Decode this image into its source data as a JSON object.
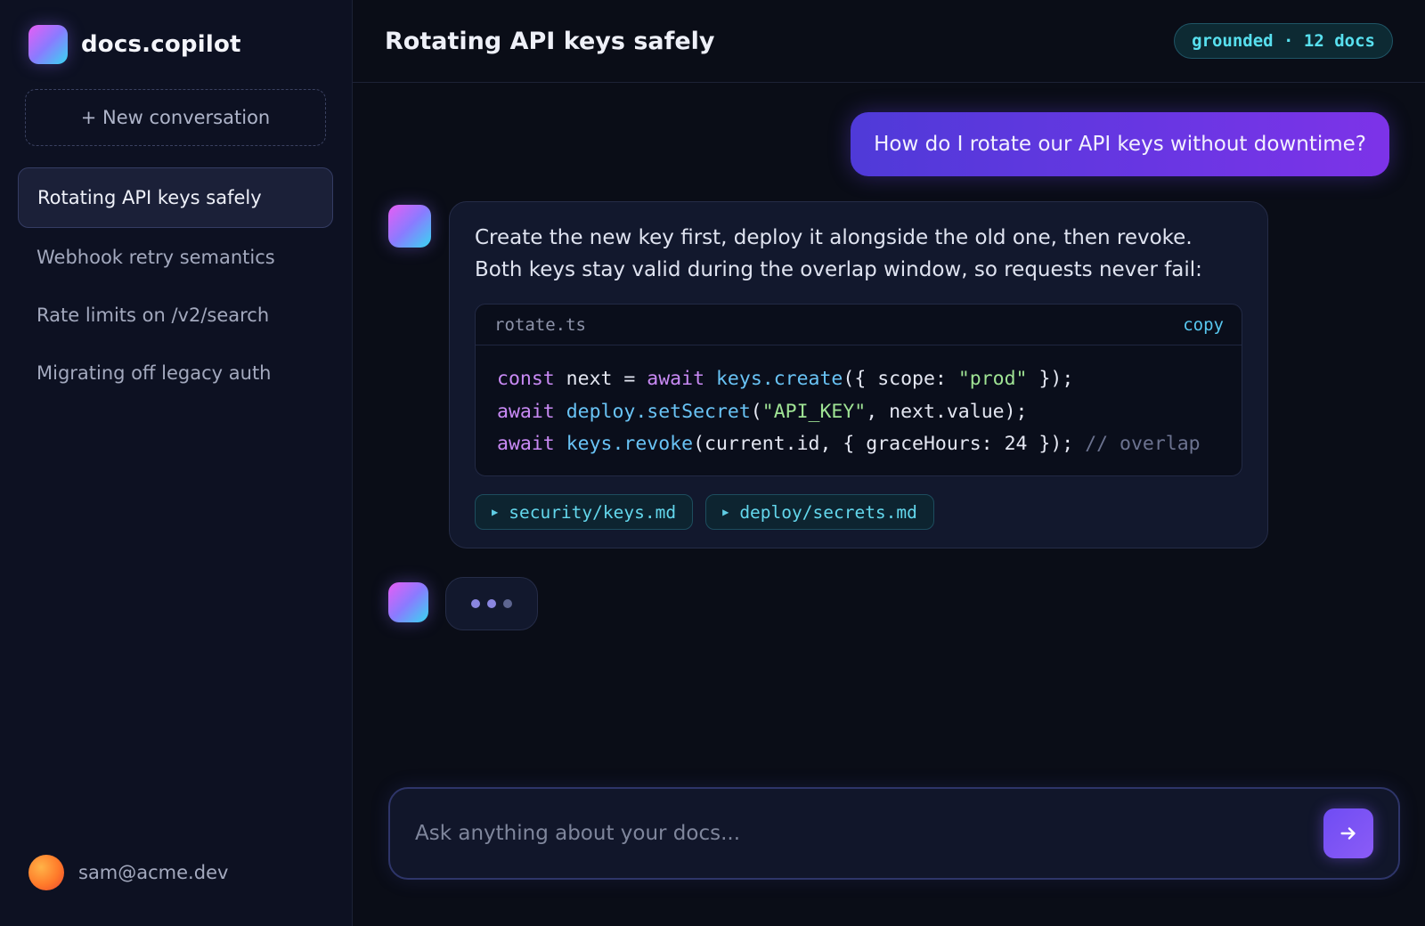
{
  "brand": {
    "name": "docs.copilot"
  },
  "sidebar": {
    "new_conversation_label": "+ New conversation",
    "conversations": [
      {
        "label": "Rotating API keys safely",
        "active": true
      },
      {
        "label": "Webhook retry semantics",
        "active": false
      },
      {
        "label": "Rate limits on /v2/search",
        "active": false
      },
      {
        "label": "Migrating off legacy auth",
        "active": false
      }
    ],
    "user_email": "sam@acme.dev"
  },
  "header": {
    "title": "Rotating API keys safely",
    "badge": "grounded · 12 docs"
  },
  "messages": {
    "user": "How do I rotate our API keys without downtime?",
    "assistant": {
      "line1": "Create the new key first, deploy it alongside the old one, then revoke.",
      "line2": "Both keys stay valid during the overlap window, so requests never fail:",
      "code": {
        "filename": "rotate.ts",
        "copy_label": "copy",
        "lines": [
          "const next = await keys.create({ scope: \"prod\" });",
          "await deploy.setSecret(\"API_KEY\", next.value);",
          "await keys.revoke(current.id, { graceHours: 24 }); // overlap"
        ]
      },
      "sources": [
        "security/keys.md",
        "deploy/secrets.md"
      ]
    }
  },
  "composer": {
    "placeholder": "Ask anything about your docs..."
  },
  "icons": {
    "send": "arrow-right-icon",
    "source_chip": "play-triangle-icon"
  },
  "colors": {
    "accent": "#7c4dff",
    "badge_text": "#58e0ef",
    "background": "#0a0d17"
  }
}
